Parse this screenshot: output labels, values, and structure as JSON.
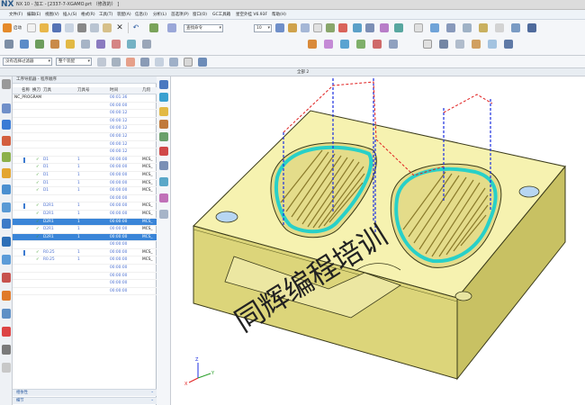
{
  "app": {
    "logo": "NX",
    "title": "NX 10 - 加工 - [2337-7-XGAMO.prt （修改的） ]"
  },
  "menu": [
    "文件(F)",
    "编辑(E)",
    "视图(V)",
    "插入(S)",
    "格式(R)",
    "工具(T)",
    "装配(A)",
    "信息(I)",
    "分析(L)",
    "首选项(P)",
    "窗口(O)",
    "GC工具箱",
    "星空外挂 V6.93F",
    "帮助(H)"
  ],
  "toolbar": {
    "start_label": "启动",
    "search_placeholder": "查找命令",
    "number_value": "10",
    "filter_value": "没有选择过滤器",
    "assembly_value": "整个装配"
  },
  "tabs": {
    "part_tab": "全部 2"
  },
  "navigator": {
    "title": "工序导航器 - 程序顺序",
    "columns": [
      "名称",
      "换刀",
      "刀具",
      "刀具号",
      "时间",
      "几何"
    ],
    "rows": [
      {
        "name": "NC_PROGRAM",
        "tool": "",
        "num": "",
        "time": "00:01:36",
        "geom": "",
        "state": "root"
      },
      {
        "name": "",
        "tool": "",
        "num": "",
        "time": "00:00:00",
        "geom": "",
        "state": ""
      },
      {
        "name": "",
        "tool": "",
        "num": "",
        "time": "00:00:12",
        "geom": "",
        "state": ""
      },
      {
        "name": "",
        "tool": "",
        "num": "",
        "time": "00:00:12",
        "geom": "",
        "state": ""
      },
      {
        "name": "",
        "tool": "",
        "num": "",
        "time": "00:00:12",
        "geom": "",
        "state": ""
      },
      {
        "name": "",
        "tool": "",
        "num": "",
        "time": "00:00:12",
        "geom": "",
        "state": ""
      },
      {
        "name": "",
        "tool": "",
        "num": "",
        "time": "00:00:12",
        "geom": "",
        "state": ""
      },
      {
        "name": "",
        "tool": "",
        "num": "",
        "time": "00:00:12",
        "geom": "",
        "state": ""
      },
      {
        "name": "",
        "tool": "D1",
        "num": "1",
        "time": "00:00:00",
        "geom": "MCS_",
        "state": "check-blue"
      },
      {
        "name": "",
        "tool": "D1",
        "num": "1",
        "time": "00:00:00",
        "geom": "MCS_",
        "state": "check"
      },
      {
        "name": "",
        "tool": "D1",
        "num": "1",
        "time": "00:00:00",
        "geom": "MCS_",
        "state": "check"
      },
      {
        "name": "",
        "tool": "D1",
        "num": "1",
        "time": "00:00:00",
        "geom": "MCS_",
        "state": "check"
      },
      {
        "name": "",
        "tool": "D1",
        "num": "1",
        "time": "00:00:00",
        "geom": "MCS_",
        "state": "check"
      },
      {
        "name": "",
        "tool": "",
        "num": "",
        "time": "00:00:00",
        "geom": "",
        "state": ""
      },
      {
        "name": "",
        "tool": "D2R1",
        "num": "1",
        "time": "00:00:00",
        "geom": "MCS_",
        "state": "check-blue"
      },
      {
        "name": "",
        "tool": "D2R1",
        "num": "1",
        "time": "00:00:00",
        "geom": "MCS_",
        "state": "check"
      },
      {
        "name": "",
        "tool": "D2R1",
        "num": "1",
        "time": "00:00:00",
        "geom": "MCS_",
        "state": "hl"
      },
      {
        "name": "",
        "tool": "D2R1",
        "num": "1",
        "time": "00:00:00",
        "geom": "MCS_",
        "state": "check"
      },
      {
        "name": "",
        "tool": "D2R1",
        "num": "1",
        "time": "00:00:00",
        "geom": "MCS_",
        "state": "hl"
      },
      {
        "name": "",
        "tool": "",
        "num": "",
        "time": "00:00:00",
        "geom": "",
        "state": ""
      },
      {
        "name": "",
        "tool": "R0.25",
        "num": "1",
        "time": "00:00:00",
        "geom": "MCS_",
        "state": "check-blue"
      },
      {
        "name": "",
        "tool": "R0.25",
        "num": "1",
        "time": "00:00:00",
        "geom": "MCS_",
        "state": "check"
      },
      {
        "name": "",
        "tool": "",
        "num": "",
        "time": "00:00:00",
        "geom": "",
        "state": ""
      },
      {
        "name": "",
        "tool": "",
        "num": "",
        "time": "00:00:00",
        "geom": "",
        "state": ""
      },
      {
        "name": "",
        "tool": "",
        "num": "",
        "time": "00:00:00",
        "geom": "",
        "state": ""
      },
      {
        "name": "",
        "tool": "",
        "num": "",
        "time": "00:00:00",
        "geom": "",
        "state": ""
      }
    ],
    "footer_1": "相依性",
    "footer_2": "细节"
  },
  "viewport": {
    "watermark": "同辉编程培训",
    "axis_z": "Z",
    "axis_y": "Y",
    "axis_x": "X",
    "colors": {
      "plate": "#f4f0a8",
      "plate_side": "#d8d276",
      "edge": "#3a3a1a",
      "cyan": "#28d0c8",
      "tool_path_blue": "#1c2ee0",
      "tool_path_red": "#e02020"
    }
  }
}
